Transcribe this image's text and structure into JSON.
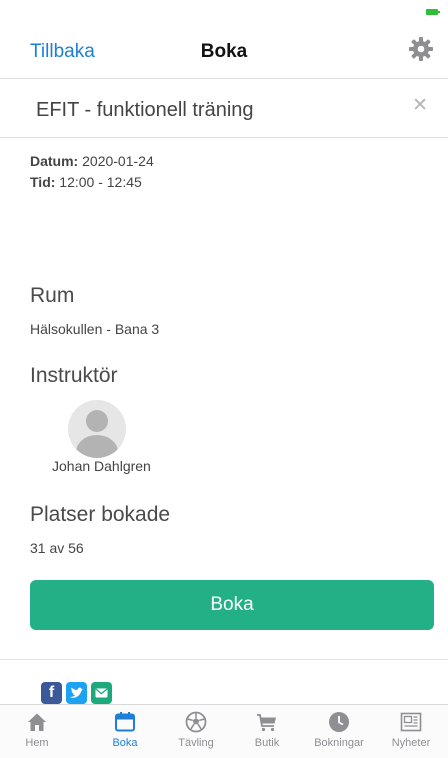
{
  "nav": {
    "back_label": "Tillbaka",
    "title": "Boka"
  },
  "event": {
    "title": "EFIT - funktionell träning",
    "date_label": "Datum:",
    "date_value": "2020-01-24",
    "time_label": "Tid:",
    "time_value": "12:00 - 12:45"
  },
  "room": {
    "heading": "Rum",
    "value": "Hälsokullen - Bana 3"
  },
  "instructor": {
    "heading": "Instruktör",
    "name": "Johan Dahlgren"
  },
  "seats": {
    "heading": "Platser bokade",
    "value": "31 av 56"
  },
  "book_button_label": "Boka",
  "share": [
    {
      "icon": "facebook-icon",
      "glyph": "f",
      "color": "#3b5998"
    },
    {
      "icon": "twitter-icon",
      "glyph": "",
      "color": "#1da1f2"
    },
    {
      "icon": "email-icon",
      "glyph": "",
      "color": "#1ea97c"
    }
  ],
  "tabs": [
    {
      "label": "Hem",
      "icon": "home-icon",
      "active": false
    },
    {
      "label": "Boka",
      "icon": "calendar-icon",
      "active": true
    },
    {
      "label": "Tävling",
      "icon": "soccer-ball-icon",
      "active": false
    },
    {
      "label": "Butik",
      "icon": "cart-icon",
      "active": false
    },
    {
      "label": "Bokningar",
      "icon": "clock-icon",
      "active": false
    },
    {
      "label": "Nyheter",
      "icon": "newspaper-icon",
      "active": false
    }
  ],
  "colors": {
    "accent": "#1e7fd8",
    "button": "#24b086",
    "inactive_tab": "#8e8e93"
  }
}
